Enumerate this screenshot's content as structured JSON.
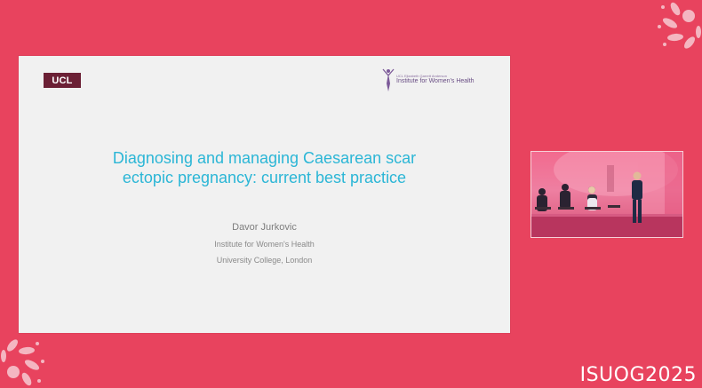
{
  "slide": {
    "ucl_logo": "UCL",
    "iwh_logo_small": "UCL Elizabeth Garrett Anderson",
    "iwh_logo_main": "Institute for Women's Health",
    "title_line1": "Diagnosing and managing Caesarean scar",
    "title_line2": "ectopic pregnancy: current best practice",
    "presenter": "Davor Jurkovic",
    "affiliation_1": "Institute for Women's Health",
    "affiliation_2": "University College, London"
  },
  "branding": {
    "event": "ISUOG2025"
  },
  "colors": {
    "background": "#e8435e",
    "slide": "#f1f1f1",
    "title": "#2bb6d6"
  }
}
